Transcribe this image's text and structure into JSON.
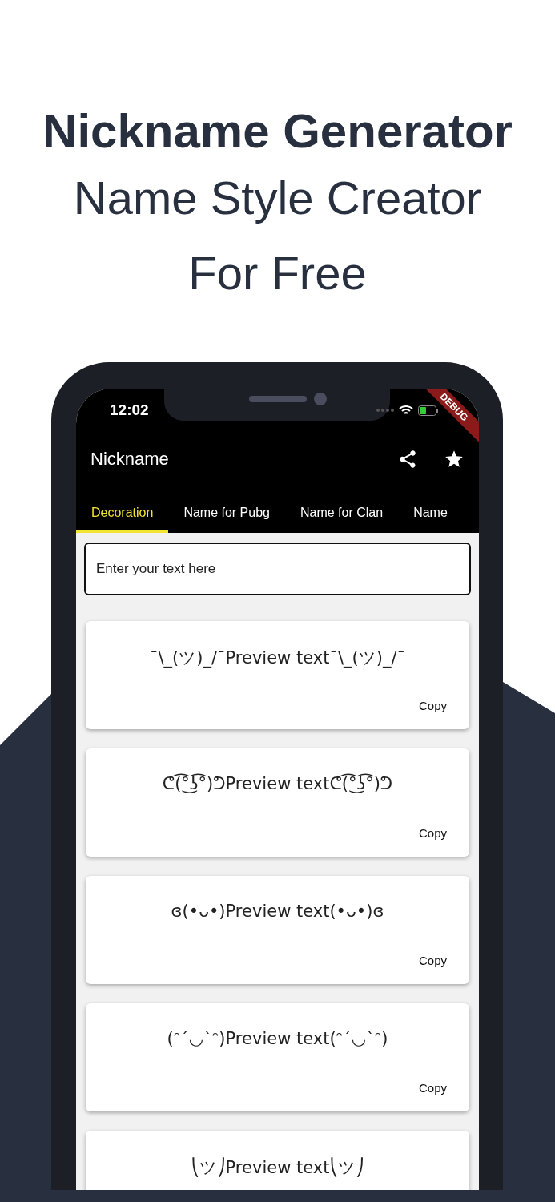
{
  "headline": {
    "title": "Nickname Generator",
    "subtitle_lines": [
      "Name Style Creator",
      "For Free"
    ]
  },
  "status_bar": {
    "time": "12:02"
  },
  "debug_banner": "DEBUG",
  "app_bar": {
    "title": "Nickname"
  },
  "tabs": [
    {
      "label": "Decoration",
      "selected": true
    },
    {
      "label": "Name for Pubg",
      "selected": false
    },
    {
      "label": "Name for Clan",
      "selected": false
    },
    {
      "label": "Name",
      "selected": false
    }
  ],
  "input": {
    "placeholder": "Enter your text here"
  },
  "cards": [
    {
      "preview": "¯\\_(ツ)_/¯Preview text¯\\_(ツ)_/¯",
      "action": "Copy"
    },
    {
      "preview": "ᕦ(͡°͜ʖ͡°)ᕤPreview textᕦ(͡°͜ʖ͡°)ᕤ",
      "action": "Copy"
    },
    {
      "preview": "ɞ(•ᴗ•)Preview text(•ᴗ•)ɞ",
      "action": "Copy"
    },
    {
      "preview": "(ᵔ´◡`ᵔ)Preview text(ᵔ´◡`ᵔ)",
      "action": "Copy"
    },
    {
      "preview": "⎝ツ⎠Preview text⎝ツ⎠"
    }
  ]
}
